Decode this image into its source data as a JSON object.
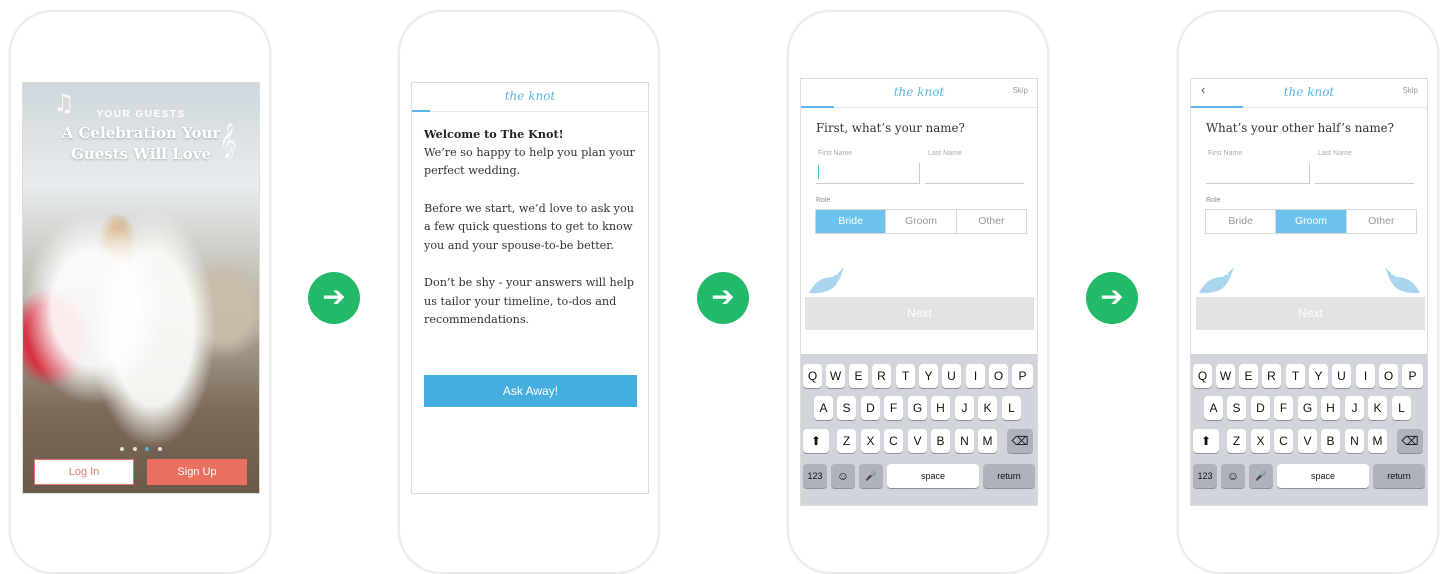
{
  "screen1": {
    "eyebrow": "YOUR GUESTS",
    "title_line1": "A Celebration Your",
    "title_line2": "Guests Will Love",
    "login": "Log In",
    "signup": "Sign Up",
    "carousel_dots": 4,
    "active_dot": 3
  },
  "screen2": {
    "logo": "the knot",
    "welcome_heading": "Welcome to The Knot!",
    "para1": "We’re so happy to help you plan your perfect wedding.",
    "para2": "Before we start, we’d love to ask you a few quick questions to get to know you and your spouse-to-be better.",
    "para3": "Don’t be shy - your answers will help us tailor your timeline, to-dos and recommendations.",
    "cta": "Ask Away!"
  },
  "screen3": {
    "logo": "the knot",
    "skip": "Skip",
    "question": "First, what’s your name?",
    "first_name_label": "First Name",
    "last_name_label": "Last Name",
    "role_label": "Role",
    "roles": [
      "Bride",
      "Groom",
      "Other"
    ],
    "selected_role": "Bride",
    "next": "Next"
  },
  "screen4": {
    "logo": "the knot",
    "skip": "Skip",
    "back": "‹",
    "question": "What’s your other half’s name?",
    "first_name_label": "First Name",
    "last_name_label": "Last Name",
    "role_label": "Role",
    "roles": [
      "Bride",
      "Groom",
      "Other"
    ],
    "selected_role": "Groom",
    "next": "Next"
  },
  "keyboard": {
    "row1": [
      "Q",
      "W",
      "E",
      "R",
      "T",
      "Y",
      "U",
      "I",
      "O",
      "P"
    ],
    "row2": [
      "A",
      "S",
      "D",
      "F",
      "G",
      "H",
      "J",
      "K",
      "L"
    ],
    "row3": [
      "Z",
      "X",
      "C",
      "V",
      "B",
      "N",
      "M"
    ],
    "shift": "⬆",
    "delete": "⌫",
    "numbers": "123",
    "emoji": "☺",
    "mic": "🎤",
    "space": "space",
    "return": "return"
  },
  "arrow_glyph": "➔",
  "colors": {
    "accent_blue": "#45aede",
    "green_arrow": "#22b968",
    "coral": "#e96f5f"
  }
}
